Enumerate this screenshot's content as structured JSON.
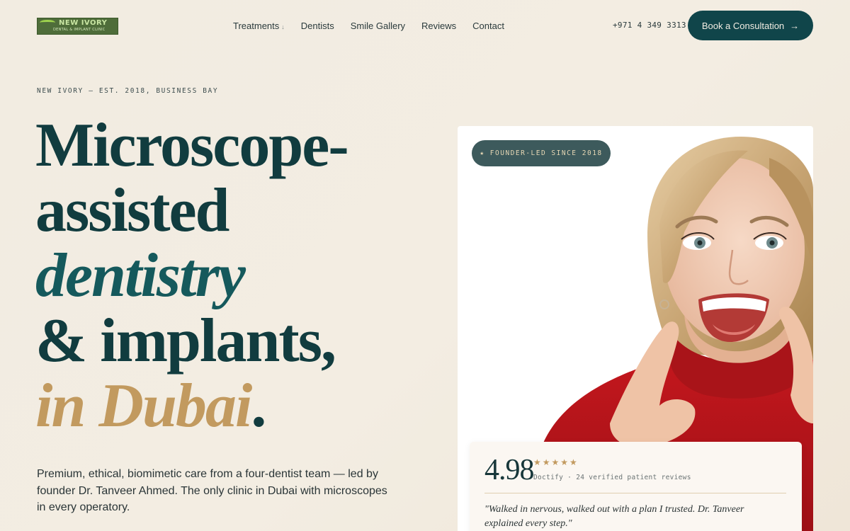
{
  "logo": {
    "name": "NEW IVORY",
    "tagline": "DENTAL & IMPLANT CLINIC"
  },
  "nav": {
    "items": [
      {
        "label": "Treatments",
        "caret": "↓"
      },
      {
        "label": "Dentists"
      },
      {
        "label": "Smile Gallery"
      },
      {
        "label": "Reviews"
      },
      {
        "label": "Contact"
      }
    ]
  },
  "header": {
    "phone": "+971 4 349 3313",
    "cta_label": "Book a Consultation",
    "cta_arrow": "→"
  },
  "hero": {
    "eyebrow": "NEW IVORY — EST. 2018, BUSINESS BAY",
    "headline": {
      "line1": "Microscope-",
      "line2": "assisted",
      "line3": "dentistry",
      "line4": "& implants,",
      "line5": "in Dubai",
      "line5_end": "."
    },
    "lead": "Premium, ethical, biomimetic care from a four-dentist team — led by founder Dr. Tanveer Ahmed. The only clinic in Dubai with microscopes in every operatory."
  },
  "photo": {
    "badge": "★ FOUNDER-LED SINCE 2018"
  },
  "rating": {
    "score": "4.98",
    "stars": "★★★★★",
    "meta": "Doctify · 24 verified patient reviews",
    "quote": "\"Walked in nervous, walked out with a plan I trusted. Dr. Tanveer explained every step.\""
  },
  "colors": {
    "background": "#f2ece1",
    "primary": "#10454a",
    "teal_accent": "#15595c",
    "gold_accent": "#c29a5f",
    "badge": "#3d5a5c",
    "sweater_red": "#b8161c"
  }
}
